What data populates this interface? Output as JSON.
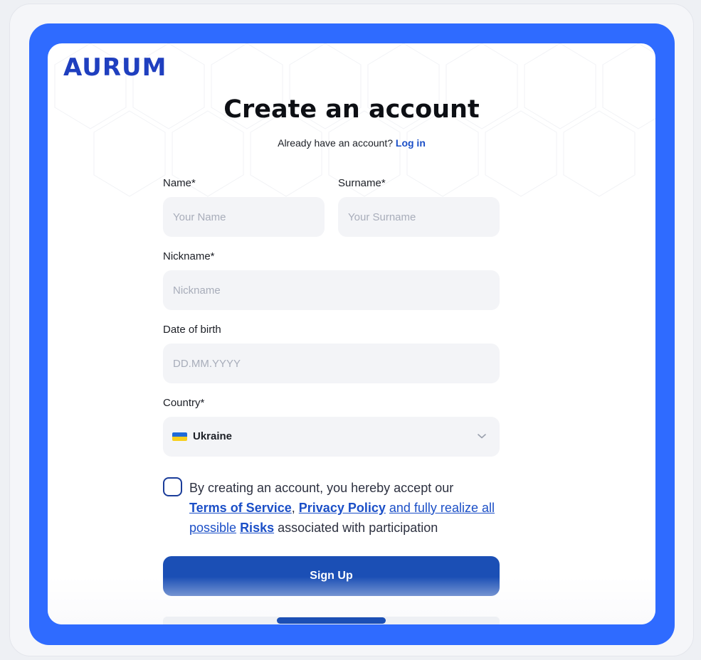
{
  "brand": {
    "logo_text": "AURUM"
  },
  "header": {
    "title": "Create an account",
    "login_prompt": "Already have an account?",
    "login_link": "Log in"
  },
  "form": {
    "name": {
      "label": "Name*",
      "placeholder": "Your Name",
      "value": ""
    },
    "surname": {
      "label": "Surname*",
      "placeholder": "Your Surname",
      "value": ""
    },
    "nickname": {
      "label": "Nickname*",
      "placeholder": "Nickname",
      "value": ""
    },
    "dob": {
      "label": "Date of birth",
      "placeholder": "DD.MM.YYYY",
      "value": ""
    },
    "country": {
      "label": "Country*",
      "selected": "Ukraine",
      "flag_icon": "ukraine-flag-icon"
    },
    "terms": {
      "checked": false,
      "prefix": "By creating an account, you hereby accept our",
      "terms_link": "Terms of Service",
      "comma": ",",
      "privacy_link": "Privacy Policy",
      "middle_link": "and fully realize all possible",
      "risks_link": "Risks",
      "suffix": "associated with participation"
    },
    "submit_label": "Sign Up"
  },
  "colors": {
    "frame_blue": "#2f6bff",
    "primary_button": "#1b4fb5",
    "link_blue": "#1b4fc7",
    "logo_blue": "#1f3fbf",
    "flag_blue": "#1f6ad9",
    "flag_yellow": "#f7cf1e"
  }
}
